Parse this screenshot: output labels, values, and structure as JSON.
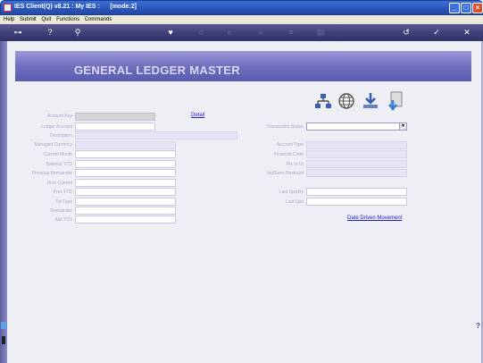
{
  "window": {
    "title": "IES Client(Q) v8.21 : My IES :      [mode:2]"
  },
  "menu": {
    "items": [
      "Help",
      "Submit",
      "Quit",
      "Functions",
      "Commands"
    ]
  },
  "page": {
    "title": "GENERAL LEDGER MASTER"
  },
  "left_form": {
    "labels": [
      "Account Key",
      "Ledger Account",
      "Description",
      "Managed Currency",
      "Current Month",
      "Balance YTD",
      "Previous Remainder",
      "Prvs Current",
      "Prvs YTD",
      "Tot Type",
      "Remainder",
      "Alst YTD"
    ],
    "detail_link": "Detail"
  },
  "right_form": {
    "labels": [
      "Transaction Status",
      "Account Type",
      "Financial Code",
      "Pls or Ut",
      "Ind/Error Restraint",
      "Last Upd By",
      "Last Upd"
    ],
    "movement_link": "Date Driven Movement"
  },
  "icons": {
    "toolbar": [
      "key-icon",
      "help-icon",
      "search-icon",
      "heart-icon",
      "home-icon",
      "rewind-icon",
      "fast-forward-icon",
      "list-icon",
      "document-icon",
      "undo-icon",
      "check-icon",
      "close-icon"
    ],
    "actions": [
      "hierarchy-icon",
      "globe-icon",
      "download-icon",
      "export-icon"
    ]
  },
  "colors": {
    "accent": "#5a5ab0",
    "link": "#2222cc",
    "toolbar": "#403e77"
  }
}
